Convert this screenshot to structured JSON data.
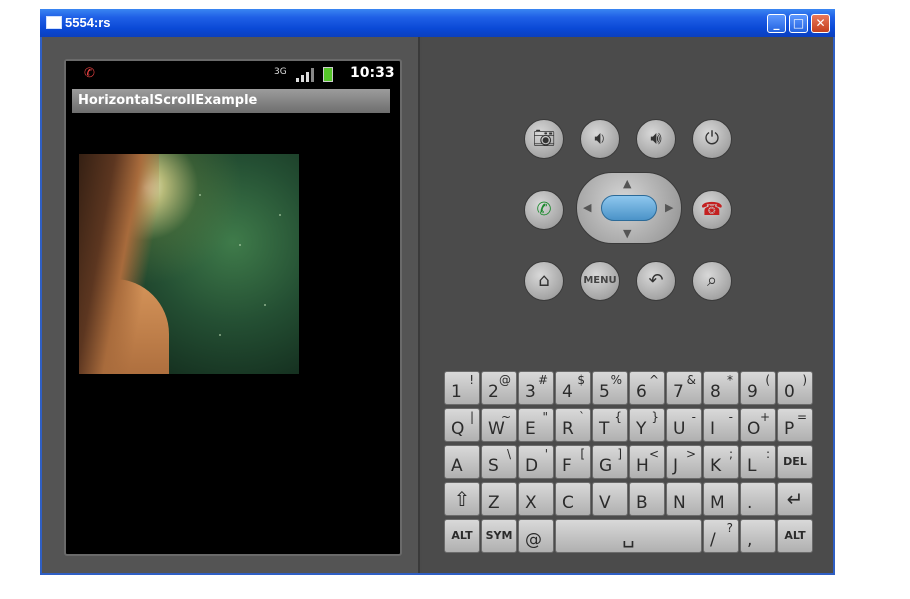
{
  "window": {
    "title": "5554:rs",
    "buttons": [
      "_",
      "□",
      "✕"
    ]
  },
  "device": {
    "status": {
      "time": "10:33",
      "network": "3G"
    },
    "app_title": "HorizontalScrollExample"
  },
  "controls": {
    "menu_label": "MENU",
    "icons": [
      "camera-icon",
      "volume-down-icon",
      "volume-up-icon",
      "power-icon",
      "call-icon",
      "end-call-icon",
      "home-icon",
      "back-icon",
      "search-icon"
    ]
  },
  "keyboard": {
    "rows": [
      [
        [
          "1",
          "!"
        ],
        [
          "2",
          "@"
        ],
        [
          "3",
          "#"
        ],
        [
          "4",
          "$"
        ],
        [
          "5",
          "%"
        ],
        [
          "6",
          "^"
        ],
        [
          "7",
          "&"
        ],
        [
          "8",
          "*"
        ],
        [
          "9",
          "("
        ],
        [
          "0",
          ")"
        ]
      ],
      [
        [
          "Q",
          "|"
        ],
        [
          "W",
          "~"
        ],
        [
          "E",
          "\""
        ],
        [
          "R",
          "`"
        ],
        [
          "T",
          "{"
        ],
        [
          "Y",
          "}"
        ],
        [
          "U",
          "-"
        ],
        [
          "I",
          "-"
        ],
        [
          "O",
          "+"
        ],
        [
          "P",
          "="
        ]
      ],
      [
        [
          "A",
          ""
        ],
        [
          "S",
          "\\"
        ],
        [
          "D",
          "'"
        ],
        [
          "F",
          "["
        ],
        [
          "G",
          "]"
        ],
        [
          "H",
          "<"
        ],
        [
          "J",
          ">"
        ],
        [
          "K",
          ";"
        ],
        [
          "L",
          ":"
        ],
        [
          "DEL",
          ""
        ]
      ],
      [
        [
          "⇧",
          ""
        ],
        [
          "Z",
          ""
        ],
        [
          "X",
          ""
        ],
        [
          "C",
          ""
        ],
        [
          "V",
          ""
        ],
        [
          "B",
          ""
        ],
        [
          "N",
          ""
        ],
        [
          "M",
          ""
        ],
        [
          ".",
          ""
        ],
        [
          "↵",
          ""
        ]
      ]
    ],
    "bottom": {
      "alt_left": "ALT",
      "sym": "SYM",
      "at": "@",
      "space": "␣",
      "slash": "/",
      "slash_sub": "?",
      "comma": ",",
      "alt_right": "ALT"
    }
  }
}
